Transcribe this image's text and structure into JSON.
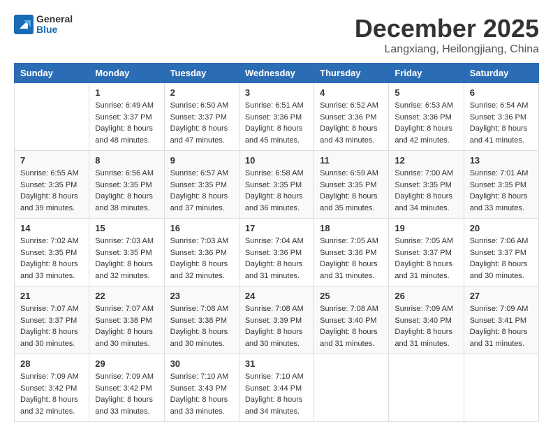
{
  "logo": {
    "general": "General",
    "blue": "Blue"
  },
  "header": {
    "month": "December 2025",
    "location": "Langxiang, Heilongjiang, China"
  },
  "weekdays": [
    "Sunday",
    "Monday",
    "Tuesday",
    "Wednesday",
    "Thursday",
    "Friday",
    "Saturday"
  ],
  "weeks": [
    [
      {
        "day": "",
        "info": ""
      },
      {
        "day": "1",
        "info": "Sunrise: 6:49 AM\nSunset: 3:37 PM\nDaylight: 8 hours\nand 48 minutes."
      },
      {
        "day": "2",
        "info": "Sunrise: 6:50 AM\nSunset: 3:37 PM\nDaylight: 8 hours\nand 47 minutes."
      },
      {
        "day": "3",
        "info": "Sunrise: 6:51 AM\nSunset: 3:36 PM\nDaylight: 8 hours\nand 45 minutes."
      },
      {
        "day": "4",
        "info": "Sunrise: 6:52 AM\nSunset: 3:36 PM\nDaylight: 8 hours\nand 43 minutes."
      },
      {
        "day": "5",
        "info": "Sunrise: 6:53 AM\nSunset: 3:36 PM\nDaylight: 8 hours\nand 42 minutes."
      },
      {
        "day": "6",
        "info": "Sunrise: 6:54 AM\nSunset: 3:36 PM\nDaylight: 8 hours\nand 41 minutes."
      }
    ],
    [
      {
        "day": "7",
        "info": "Sunrise: 6:55 AM\nSunset: 3:35 PM\nDaylight: 8 hours\nand 39 minutes."
      },
      {
        "day": "8",
        "info": "Sunrise: 6:56 AM\nSunset: 3:35 PM\nDaylight: 8 hours\nand 38 minutes."
      },
      {
        "day": "9",
        "info": "Sunrise: 6:57 AM\nSunset: 3:35 PM\nDaylight: 8 hours\nand 37 minutes."
      },
      {
        "day": "10",
        "info": "Sunrise: 6:58 AM\nSunset: 3:35 PM\nDaylight: 8 hours\nand 36 minutes."
      },
      {
        "day": "11",
        "info": "Sunrise: 6:59 AM\nSunset: 3:35 PM\nDaylight: 8 hours\nand 35 minutes."
      },
      {
        "day": "12",
        "info": "Sunrise: 7:00 AM\nSunset: 3:35 PM\nDaylight: 8 hours\nand 34 minutes."
      },
      {
        "day": "13",
        "info": "Sunrise: 7:01 AM\nSunset: 3:35 PM\nDaylight: 8 hours\nand 33 minutes."
      }
    ],
    [
      {
        "day": "14",
        "info": "Sunrise: 7:02 AM\nSunset: 3:35 PM\nDaylight: 8 hours\nand 33 minutes."
      },
      {
        "day": "15",
        "info": "Sunrise: 7:03 AM\nSunset: 3:35 PM\nDaylight: 8 hours\nand 32 minutes."
      },
      {
        "day": "16",
        "info": "Sunrise: 7:03 AM\nSunset: 3:36 PM\nDaylight: 8 hours\nand 32 minutes."
      },
      {
        "day": "17",
        "info": "Sunrise: 7:04 AM\nSunset: 3:36 PM\nDaylight: 8 hours\nand 31 minutes."
      },
      {
        "day": "18",
        "info": "Sunrise: 7:05 AM\nSunset: 3:36 PM\nDaylight: 8 hours\nand 31 minutes."
      },
      {
        "day": "19",
        "info": "Sunrise: 7:05 AM\nSunset: 3:37 PM\nDaylight: 8 hours\nand 31 minutes."
      },
      {
        "day": "20",
        "info": "Sunrise: 7:06 AM\nSunset: 3:37 PM\nDaylight: 8 hours\nand 30 minutes."
      }
    ],
    [
      {
        "day": "21",
        "info": "Sunrise: 7:07 AM\nSunset: 3:37 PM\nDaylight: 8 hours\nand 30 minutes."
      },
      {
        "day": "22",
        "info": "Sunrise: 7:07 AM\nSunset: 3:38 PM\nDaylight: 8 hours\nand 30 minutes."
      },
      {
        "day": "23",
        "info": "Sunrise: 7:08 AM\nSunset: 3:38 PM\nDaylight: 8 hours\nand 30 minutes."
      },
      {
        "day": "24",
        "info": "Sunrise: 7:08 AM\nSunset: 3:39 PM\nDaylight: 8 hours\nand 30 minutes."
      },
      {
        "day": "25",
        "info": "Sunrise: 7:08 AM\nSunset: 3:40 PM\nDaylight: 8 hours\nand 31 minutes."
      },
      {
        "day": "26",
        "info": "Sunrise: 7:09 AM\nSunset: 3:40 PM\nDaylight: 8 hours\nand 31 minutes."
      },
      {
        "day": "27",
        "info": "Sunrise: 7:09 AM\nSunset: 3:41 PM\nDaylight: 8 hours\nand 31 minutes."
      }
    ],
    [
      {
        "day": "28",
        "info": "Sunrise: 7:09 AM\nSunset: 3:42 PM\nDaylight: 8 hours\nand 32 minutes."
      },
      {
        "day": "29",
        "info": "Sunrise: 7:09 AM\nSunset: 3:42 PM\nDaylight: 8 hours\nand 33 minutes."
      },
      {
        "day": "30",
        "info": "Sunrise: 7:10 AM\nSunset: 3:43 PM\nDaylight: 8 hours\nand 33 minutes."
      },
      {
        "day": "31",
        "info": "Sunrise: 7:10 AM\nSunset: 3:44 PM\nDaylight: 8 hours\nand 34 minutes."
      },
      {
        "day": "",
        "info": ""
      },
      {
        "day": "",
        "info": ""
      },
      {
        "day": "",
        "info": ""
      }
    ]
  ]
}
